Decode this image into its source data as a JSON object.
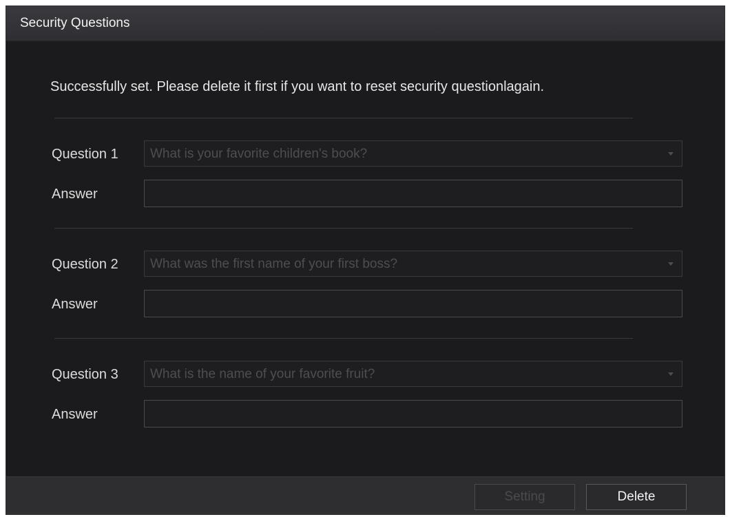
{
  "dialog": {
    "title": "Security Questions",
    "message": "Successfully set. Please delete it first if you want to reset security questionlagain."
  },
  "questions": [
    {
      "label": "Question 1",
      "value": "What is your favorite children's book?",
      "answer_label": "Answer",
      "answer": ""
    },
    {
      "label": "Question 2",
      "value": "What was the first name of your first boss?",
      "answer_label": "Answer",
      "answer": ""
    },
    {
      "label": "Question 3",
      "value": "What is the name of your favorite fruit?",
      "answer_label": "Answer",
      "answer": ""
    }
  ],
  "footer": {
    "setting_label": "Setting",
    "delete_label": "Delete"
  },
  "icons": {
    "dropdown": "chevron-down-icon"
  }
}
